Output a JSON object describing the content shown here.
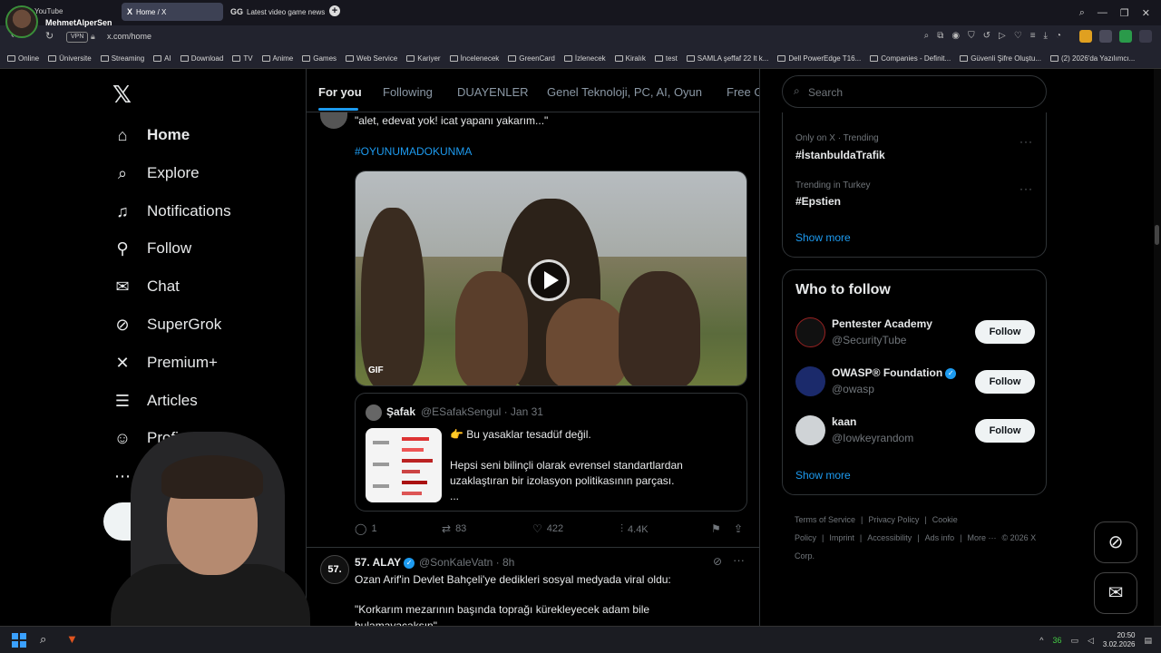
{
  "browser": {
    "profile_name": "MehmetAlperSen",
    "youtube_label": "YouTube",
    "tabs": [
      {
        "icon": "X",
        "title": "Home / X"
      },
      {
        "icon": "GG",
        "title": "Latest video game news a"
      }
    ],
    "vpn_label": "VPN",
    "url": "x.com/home",
    "bookmarks": [
      "Online",
      "Üniversite",
      "Streaming",
      "AI",
      "Download",
      "TV",
      "Anime",
      "Games",
      "Web Service",
      "Kariyer",
      "İncelenecek",
      "GreenCard",
      "İzlenecek",
      "Kiralık",
      "test",
      "SAMLA şeffaf 22 lt k...",
      "Dell PowerEdge T16...",
      "Companies - Definit...",
      "Güvenli Şifre Oluştu...",
      "(2) 2026'da Yazılımcı..."
    ]
  },
  "sidebar": {
    "items": [
      {
        "label": "Home",
        "icon": "home-icon"
      },
      {
        "label": "Explore",
        "icon": "search-icon"
      },
      {
        "label": "Notifications",
        "icon": "bell-icon"
      },
      {
        "label": "Follow",
        "icon": "add-user-icon"
      },
      {
        "label": "Chat",
        "icon": "mail-icon"
      },
      {
        "label": "SuperGrok",
        "icon": "grok-icon"
      },
      {
        "label": "Premium+",
        "icon": "x-icon"
      },
      {
        "label": "Articles",
        "icon": "article-icon"
      },
      {
        "label": "Profi",
        "icon": "person-icon"
      },
      {
        "label": "Mo",
        "icon": "more-icon"
      }
    ]
  },
  "timeline": {
    "tabs": [
      "For you",
      "Following",
      "DUAYENLER",
      "Genel Teknoloji, PC, AI, Oyun",
      "Free G"
    ],
    "tweet1": {
      "text": "\"alet, edevat yok! icat yapanı yakarım...\"",
      "hashtag": "#OYUNUMADOKUNMA",
      "gif_label": "GIF",
      "quote": {
        "name": "Şafak",
        "handle": "@ESafakSengul · Jan 31",
        "headline": "👉 Bu yasaklar tesadüf değil.",
        "body": "Hepsi seni bilinçli olarak evrensel standartlardan uzaklaştıran bir izolasyon politikasının parçası.",
        "ellipsis": "..."
      },
      "replies": "1",
      "reposts": "83",
      "likes": "422",
      "views": "4.4K"
    },
    "tweet2": {
      "avatar_text": "57.",
      "name": "57. ALAY",
      "handle": "@SonKaleVatn · 8h",
      "text1": "Ozan Arif'in Devlet Bahçeli'ye dedikleri sosyal medyada viral oldu:",
      "text2": "\"Korkarım mezarının başında toprağı kürekleyecek adam bile",
      "text3": "bulamayacaksın\""
    }
  },
  "right": {
    "search_placeholder": "Search",
    "trends": [
      {
        "meta": "Only on X · Trending",
        "tag": "#İstanbuldaTrafik"
      },
      {
        "meta": "Trending in Turkey",
        "tag": "#Epstien"
      }
    ],
    "trends_show_more": "Show more",
    "who_to_follow": {
      "title": "Who to follow",
      "accounts": [
        {
          "name": "Pentester Academy",
          "handle": "@SecurityTube",
          "follow": "Follow"
        },
        {
          "name": "OWASP® Foundation",
          "handle": "@owasp",
          "follow": "Follow"
        },
        {
          "name": "kaan",
          "handle": "@Iowkeyrandom",
          "follow": "Follow"
        }
      ],
      "show_more": "Show more"
    },
    "footer": [
      "Terms of Service",
      "|",
      "Privacy Policy",
      "|",
      "Cookie Policy",
      "|",
      "Imprint",
      "|",
      "Accessibility",
      "|",
      "Ads info",
      "|",
      "More ···",
      "© 2026 X Corp."
    ]
  },
  "taskbar": {
    "time": "20:50",
    "date": "3.02.2026",
    "tray_badge": "36"
  },
  "colors": {
    "accent": "#1d9bf0",
    "background": "#000000",
    "text": "#e7e9ea",
    "muted": "#71767b"
  }
}
